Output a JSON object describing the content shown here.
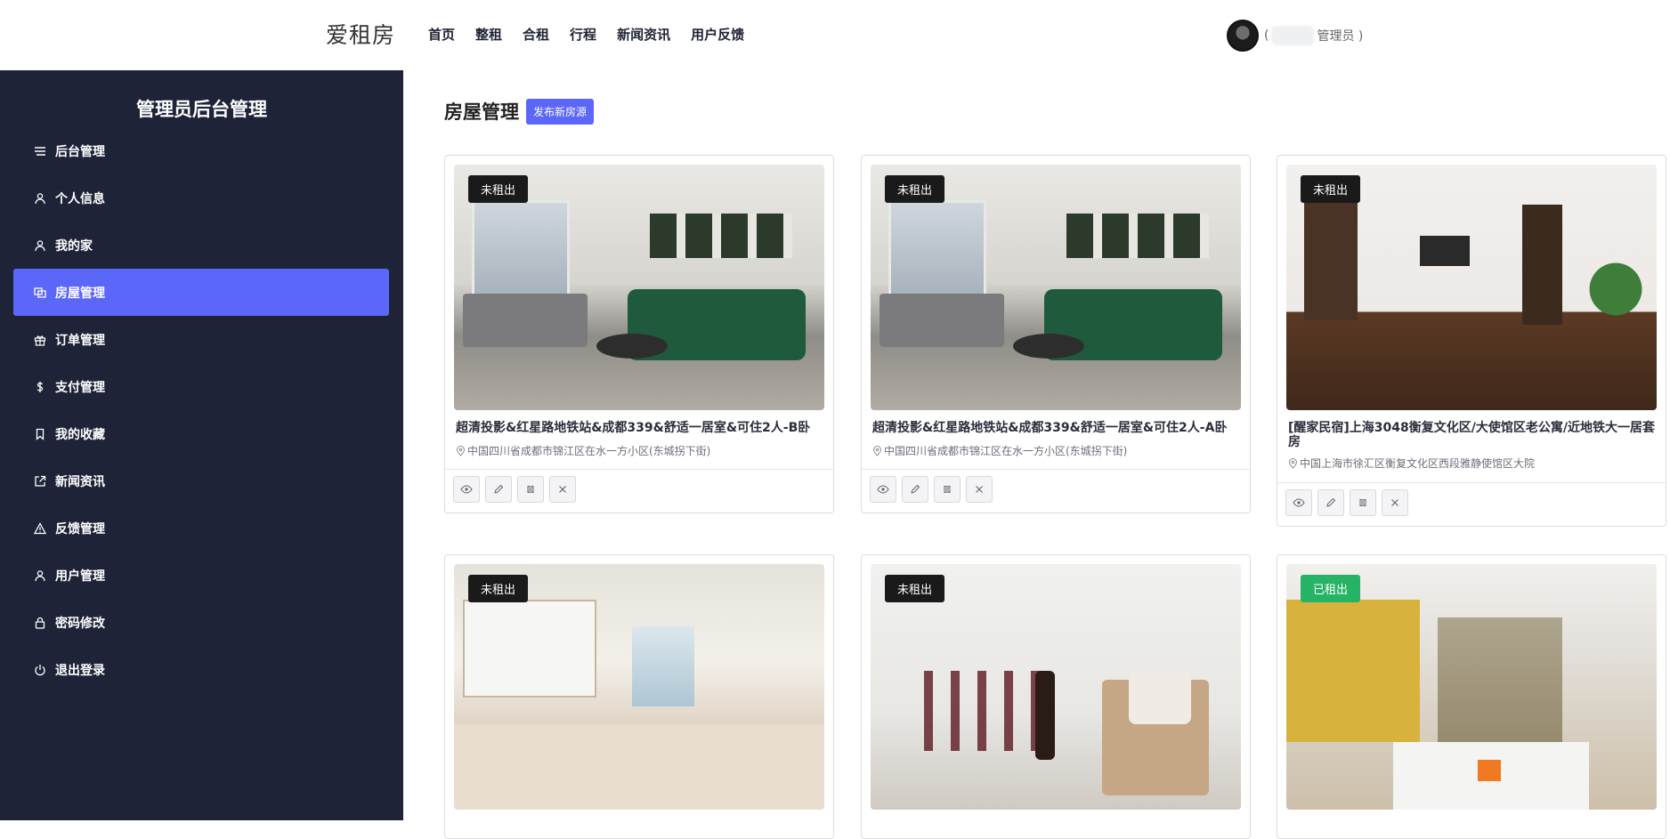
{
  "header": {
    "brand": "爱租房",
    "nav": [
      "首页",
      "整租",
      "合租",
      "行程",
      "新闻资讯",
      "用户反馈"
    ],
    "user_role_prefix": "(",
    "user_role": "管理员 )"
  },
  "sidebar": {
    "title": "管理员后台管理",
    "items": [
      {
        "label": "后台管理",
        "icon": "list-icon"
      },
      {
        "label": "个人信息",
        "icon": "user-icon"
      },
      {
        "label": "我的家",
        "icon": "user-icon"
      },
      {
        "label": "房屋管理",
        "icon": "copy-icon",
        "active": true
      },
      {
        "label": "订单管理",
        "icon": "gift-icon"
      },
      {
        "label": "支付管理",
        "icon": "dollar-icon"
      },
      {
        "label": "我的收藏",
        "icon": "bookmark-icon"
      },
      {
        "label": "新闻资讯",
        "icon": "external-link-icon"
      },
      {
        "label": "反馈管理",
        "icon": "warning-icon"
      },
      {
        "label": "用户管理",
        "icon": "user-icon"
      },
      {
        "label": "密码修改",
        "icon": "lock-icon"
      },
      {
        "label": "退出登录",
        "icon": "power-icon"
      }
    ]
  },
  "main": {
    "title": "房屋管理",
    "publish_label": "发布新房源",
    "houses": [
      {
        "status": "未租出",
        "title": "超清投影&红星路地铁站&成都339&舒适一居室&可住2人-B卧",
        "address": "中国四川省成都市锦江区在水一方小区(东城拐下街)"
      },
      {
        "status": "未租出",
        "title": "超清投影&红星路地铁站&成都339&舒适一居室&可住2人-A卧",
        "address": "中国四川省成都市锦江区在水一方小区(东城拐下街)"
      },
      {
        "status": "未租出",
        "title": "[醒家民宿]上海3048衡复文化区/大使馆区老公寓/近地铁大一居套房",
        "address": "中国上海市徐汇区衡复文化区西段雅静使馆区大院"
      },
      {
        "status": "未租出",
        "title": "",
        "address": ""
      },
      {
        "status": "未租出",
        "title": "",
        "address": ""
      },
      {
        "status": "已租出",
        "title": "",
        "address": ""
      }
    ]
  },
  "colors": {
    "sidebar_bg": "#1f2338",
    "accent": "#5a67f8",
    "rented": "#27b366"
  }
}
